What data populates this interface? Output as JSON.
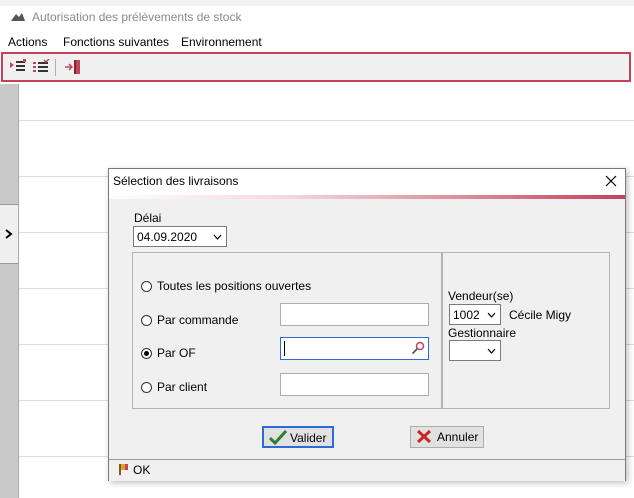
{
  "window": {
    "title": "Autorisation des prélèvements de stock",
    "menu": [
      "Actions",
      "Fonctions suivantes",
      "Environnement"
    ]
  },
  "toolbar": {
    "icons": [
      "list-run-icon",
      "checklist-icon",
      "exit-icon"
    ],
    "border_color": "#c4425a"
  },
  "dialog": {
    "title": "Sélection des livraisons",
    "delai": {
      "label": "Délai",
      "value": "04.09.2020"
    },
    "options": [
      {
        "label": "Toutes les positions ouvertes",
        "checked": false
      },
      {
        "label": "Par commande",
        "checked": false
      },
      {
        "label": "Par OF",
        "checked": true
      },
      {
        "label": "Par client",
        "checked": false
      }
    ],
    "vendeur": {
      "label": "Vendeur(se)",
      "code": "1002",
      "name": "Cécile Migy"
    },
    "gestionnaire": {
      "label": "Gestionnaire",
      "value": ""
    },
    "buttons": {
      "ok": "Valider",
      "cancel": "Annuler"
    },
    "status": "OK",
    "accent_color": "#c4425a",
    "focus_color": "#2e6bd6"
  }
}
